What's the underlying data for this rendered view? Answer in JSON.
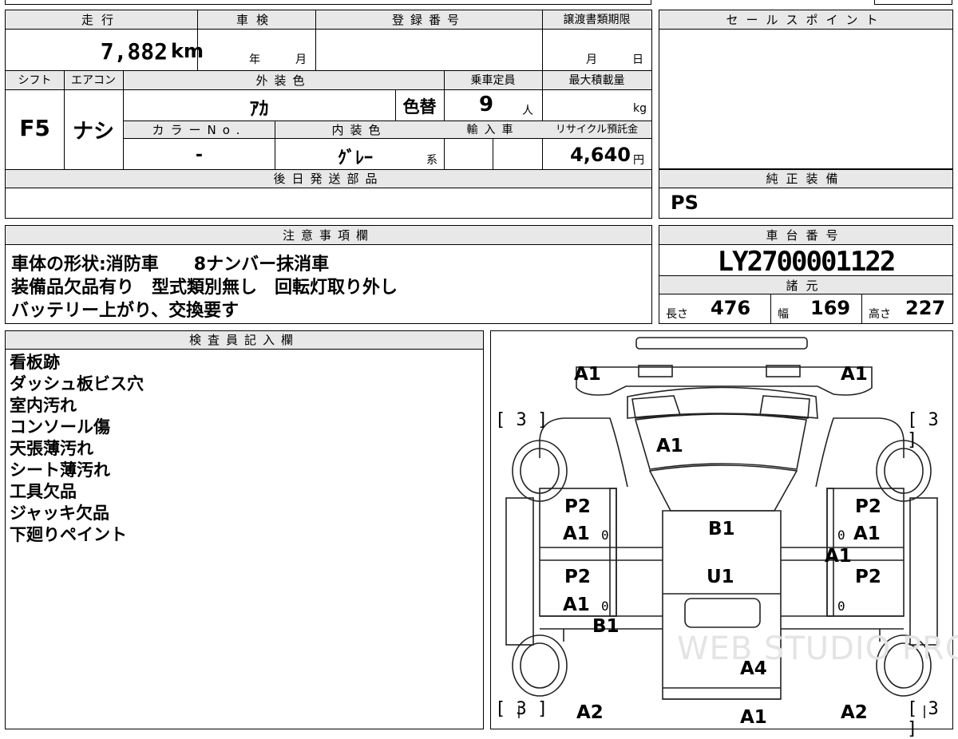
{
  "headers": {
    "mileage": "走行",
    "inspection": "車検",
    "registration": "登録番号",
    "transfer_deadline": "譲渡書類期限",
    "sale_points": "セールスポイント",
    "shift": "シフト",
    "aircon": "エアコン",
    "exterior_color": "外装色",
    "capacity": "乗車定員",
    "max_load": "最大積載量",
    "color_no": "カラーNo.",
    "interior_color": "内装色",
    "import": "輸入車",
    "recycle": "リサイクル預託金",
    "later_parts": "後日発送部品",
    "genuine_equipment": "純正装備",
    "notes": "注意事項欄",
    "chassis_no": "車台番号",
    "specs": "諸元",
    "inspector": "検査員記入欄"
  },
  "vehicle": {
    "mileage": "7,882",
    "mileage_unit": "km",
    "inspection_year_unit": "年",
    "inspection_month_unit": "月",
    "transfer_month_unit": "月",
    "transfer_day_unit": "日",
    "shift": "F5",
    "aircon": "ナシ",
    "exterior_color": "ｱｶ",
    "color_changed": "色替",
    "capacity": "9",
    "capacity_unit": "人",
    "max_load_unit": "kg",
    "color_no": "-",
    "interior_color": "ｸﾞﾚｰ",
    "interior_suffix": "系",
    "recycle_fee": "4,640",
    "recycle_unit": "円",
    "genuine_equipment": "PS",
    "chassis_no": "LY2700001122",
    "length_label": "長さ",
    "length": "476",
    "width_label": "幅",
    "width": "169",
    "height_label": "高さ",
    "height": "227"
  },
  "notes": [
    "車体の形状:消防車　　8ナンバー抹消車",
    "装備品欠品有り　型式類別無し　回転灯取り外し",
    "バッテリー上がり、交換要す"
  ],
  "inspector_items": [
    "看板跡",
    "ダッシュ板ビス穴",
    "室内汚れ",
    "コンソール傷",
    "天張薄汚れ",
    "シート薄汚れ",
    "工具欠品",
    "ジャッキ欠品",
    "下廻りペイント"
  ],
  "diagram": {
    "tire_bracket": "[ 3 ]",
    "marks": {
      "front_left": "A1",
      "front_right": "A1",
      "hood": "A1",
      "roof_front": "B1",
      "roof_mid": "U1",
      "roof_rear": "A4",
      "fl_door_p": "P2",
      "fl_door_a": "A1",
      "fr_door_p": "P2",
      "fr_door_a": "A1",
      "r_pillar": "A1",
      "rl_door_p": "P2",
      "rl_door_a": "A1",
      "rr_door_p": "P2",
      "left_sill": "B1",
      "rear_left": "A2",
      "rear_right": "A2",
      "rear_center": "A1",
      "small_zero": "0"
    }
  },
  "watermark": "WEB STUDIO PRO"
}
